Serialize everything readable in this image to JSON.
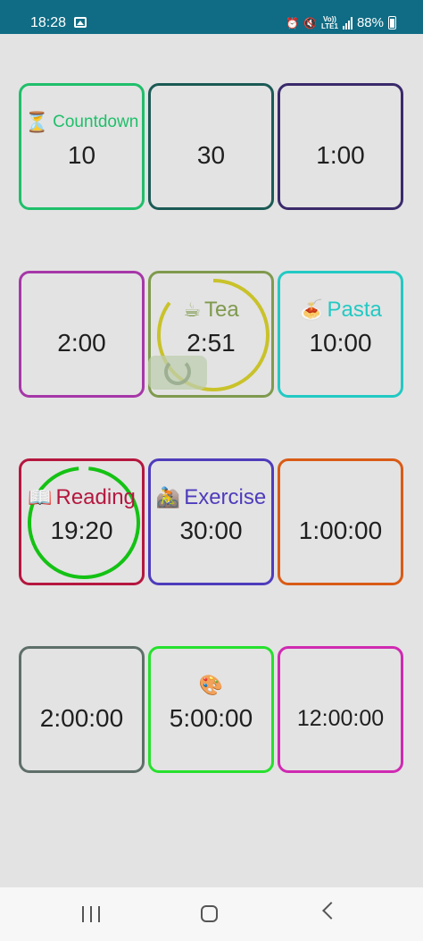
{
  "status_bar": {
    "time": "18:28",
    "battery": "88%",
    "network": "LTE1",
    "volte": "Vo))"
  },
  "timers": [
    {
      "label": "Countdown",
      "icon": "⏳",
      "icon_name": "hourglass-icon",
      "value": "10",
      "color": "#1fbf6a"
    },
    {
      "label": "",
      "icon": "",
      "value": "30",
      "color": "#1c5a55"
    },
    {
      "label": "",
      "icon": "",
      "value": "1:00",
      "color": "#3a2a6b"
    },
    {
      "label": "",
      "icon": "",
      "value": "2:00",
      "color": "#a637a8"
    },
    {
      "label": "Tea",
      "icon": "☕",
      "icon_name": "coffee-icon",
      "value": "2:51",
      "color": "#7f9a4e",
      "ring_color": "#c9c22a",
      "progress": 0.85
    },
    {
      "label": "Pasta",
      "icon": "🍝",
      "icon_name": "spaghetti-icon",
      "value": "10:00",
      "color": "#23c9c3"
    },
    {
      "label": "Reading",
      "icon": "📖",
      "icon_name": "book-icon",
      "value": "19:20",
      "color": "#b5173f",
      "ring_color": "#14c214",
      "progress": 0.97
    },
    {
      "label": "Exercise",
      "icon": "🚵",
      "icon_name": "mountain-bike-icon",
      "value": "30:00",
      "color": "#4e3cbc"
    },
    {
      "label": "",
      "icon": "",
      "value": "1:00:00",
      "color": "#d95b16"
    },
    {
      "label": "",
      "icon": "",
      "value": "2:00:00",
      "color": "#5e6f69"
    },
    {
      "label": "",
      "icon": "🎨",
      "icon_name": "palette-icon",
      "value": "5:00:00",
      "color": "#26e02d"
    },
    {
      "label": "",
      "icon": "",
      "value": "12:00:00",
      "color": "#cf2ab2"
    }
  ]
}
